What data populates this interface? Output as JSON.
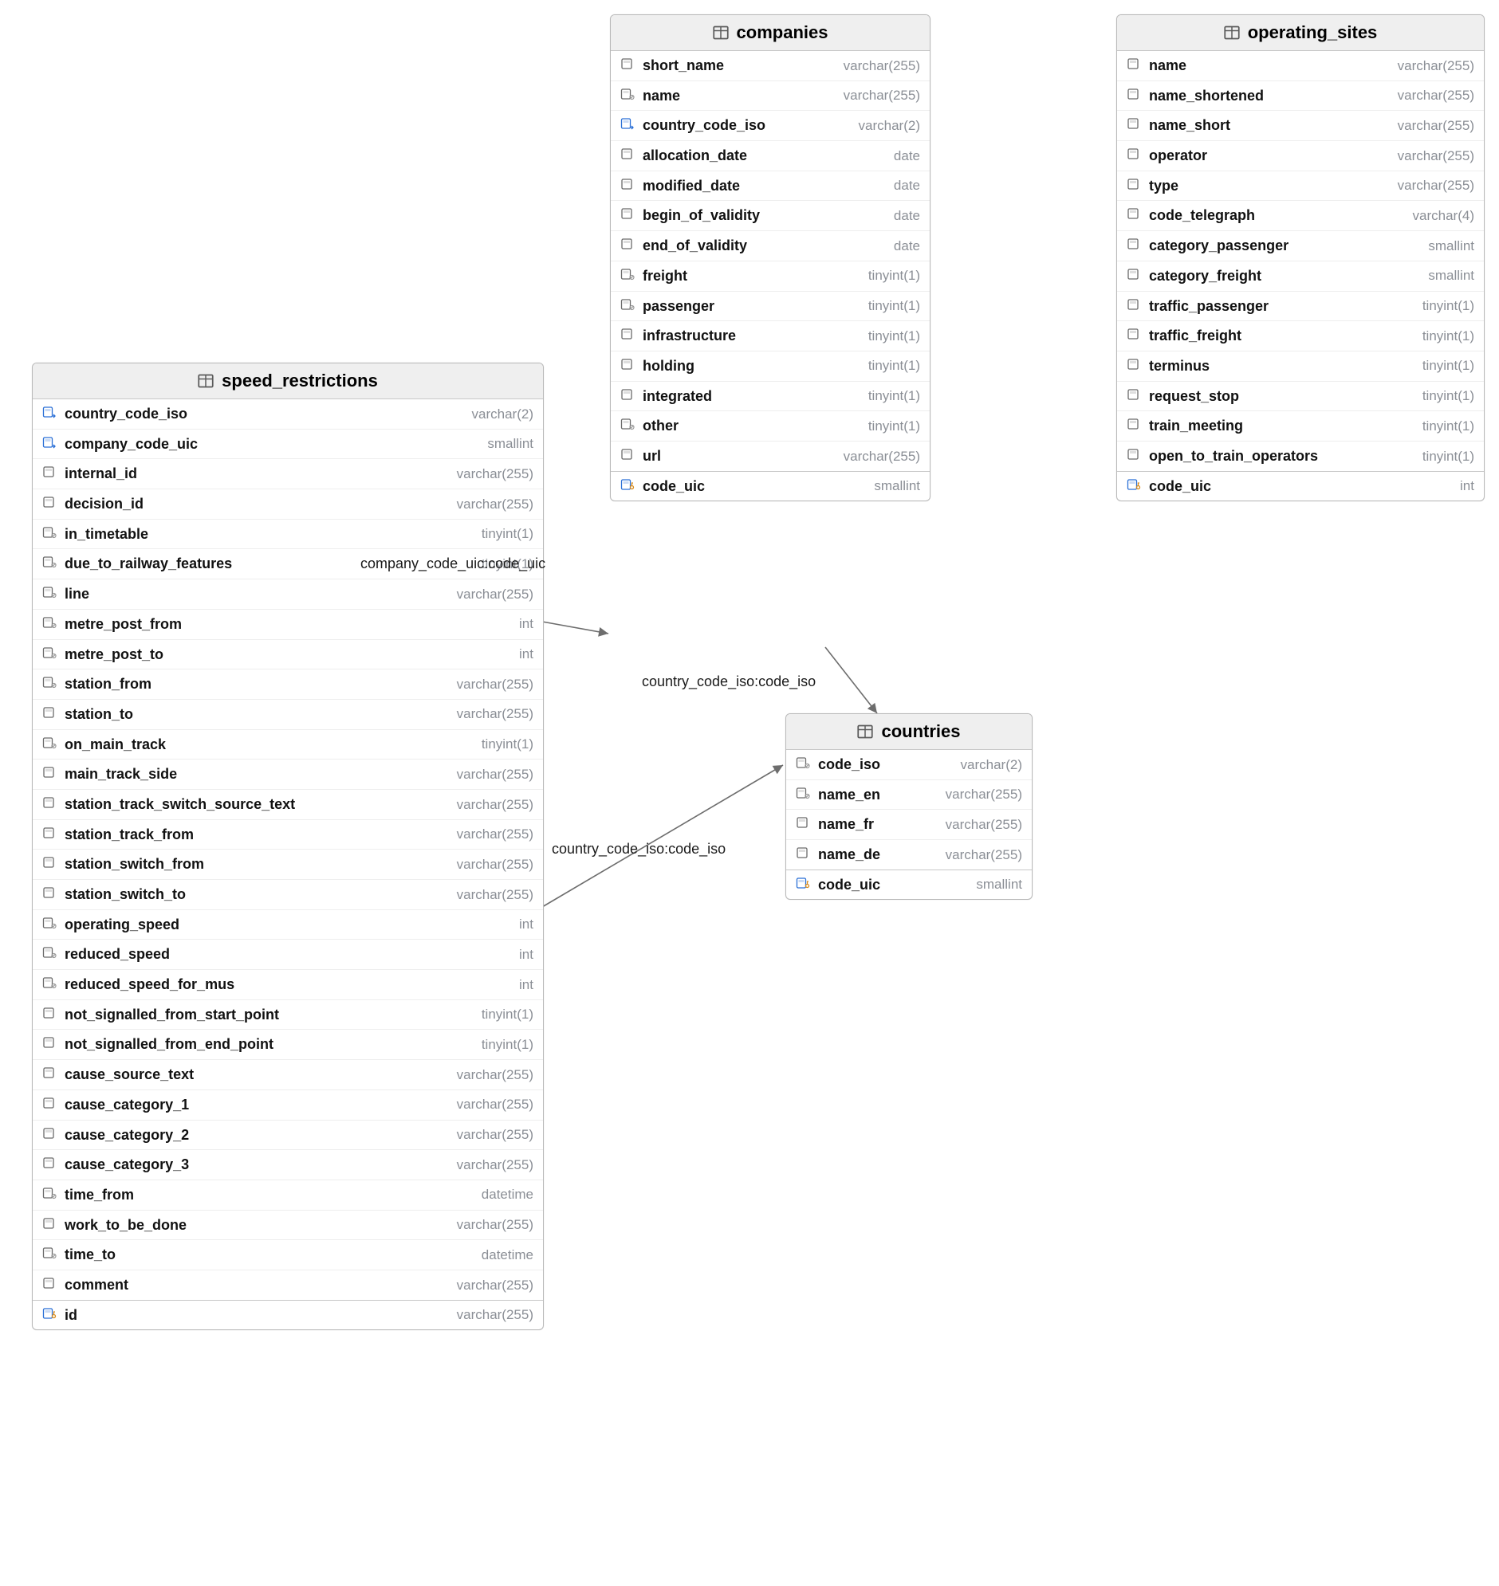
{
  "tables": {
    "speed_restrictions": {
      "title": "speed_restrictions",
      "columns": [
        {
          "icon": "fk",
          "name": "country_code_iso",
          "type": "varchar(2)"
        },
        {
          "icon": "fk",
          "name": "company_code_uic",
          "type": "smallint"
        },
        {
          "icon": "col",
          "name": "internal_id",
          "type": "varchar(255)"
        },
        {
          "icon": "col",
          "name": "decision_id",
          "type": "varchar(255)"
        },
        {
          "icon": "null",
          "name": "in_timetable",
          "type": "tinyint(1)"
        },
        {
          "icon": "null",
          "name": "due_to_railway_features",
          "type": "tinyint(1)"
        },
        {
          "icon": "null",
          "name": "line",
          "type": "varchar(255)"
        },
        {
          "icon": "null",
          "name": "metre_post_from",
          "type": "int"
        },
        {
          "icon": "null",
          "name": "metre_post_to",
          "type": "int"
        },
        {
          "icon": "null",
          "name": "station_from",
          "type": "varchar(255)"
        },
        {
          "icon": "col",
          "name": "station_to",
          "type": "varchar(255)"
        },
        {
          "icon": "null",
          "name": "on_main_track",
          "type": "tinyint(1)"
        },
        {
          "icon": "col",
          "name": "main_track_side",
          "type": "varchar(255)"
        },
        {
          "icon": "col",
          "name": "station_track_switch_source_text",
          "type": "varchar(255)"
        },
        {
          "icon": "col",
          "name": "station_track_from",
          "type": "varchar(255)"
        },
        {
          "icon": "col",
          "name": "station_switch_from",
          "type": "varchar(255)"
        },
        {
          "icon": "col",
          "name": "station_switch_to",
          "type": "varchar(255)"
        },
        {
          "icon": "null",
          "name": "operating_speed",
          "type": "int"
        },
        {
          "icon": "null",
          "name": "reduced_speed",
          "type": "int"
        },
        {
          "icon": "null",
          "name": "reduced_speed_for_mus",
          "type": "int"
        },
        {
          "icon": "col",
          "name": "not_signalled_from_start_point",
          "type": "tinyint(1)"
        },
        {
          "icon": "col",
          "name": "not_signalled_from_end_point",
          "type": "tinyint(1)"
        },
        {
          "icon": "col",
          "name": "cause_source_text",
          "type": "varchar(255)"
        },
        {
          "icon": "col",
          "name": "cause_category_1",
          "type": "varchar(255)"
        },
        {
          "icon": "col",
          "name": "cause_category_2",
          "type": "varchar(255)"
        },
        {
          "icon": "col",
          "name": "cause_category_3",
          "type": "varchar(255)"
        },
        {
          "icon": "null",
          "name": "time_from",
          "type": "datetime"
        },
        {
          "icon": "col",
          "name": "work_to_be_done",
          "type": "varchar(255)"
        },
        {
          "icon": "null",
          "name": "time_to",
          "type": "datetime"
        },
        {
          "icon": "col",
          "name": "comment",
          "type": "varchar(255)"
        },
        {
          "icon": "pk",
          "name": "id",
          "type": "varchar(255)",
          "pk": true
        }
      ]
    },
    "companies": {
      "title": "companies",
      "columns": [
        {
          "icon": "col",
          "name": "short_name",
          "type": "varchar(255)"
        },
        {
          "icon": "null",
          "name": "name",
          "type": "varchar(255)"
        },
        {
          "icon": "fk",
          "name": "country_code_iso",
          "type": "varchar(2)"
        },
        {
          "icon": "col",
          "name": "allocation_date",
          "type": "date"
        },
        {
          "icon": "col",
          "name": "modified_date",
          "type": "date"
        },
        {
          "icon": "col",
          "name": "begin_of_validity",
          "type": "date"
        },
        {
          "icon": "col",
          "name": "end_of_validity",
          "type": "date"
        },
        {
          "icon": "null",
          "name": "freight",
          "type": "tinyint(1)"
        },
        {
          "icon": "null",
          "name": "passenger",
          "type": "tinyint(1)"
        },
        {
          "icon": "col",
          "name": "infrastructure",
          "type": "tinyint(1)"
        },
        {
          "icon": "col",
          "name": "holding",
          "type": "tinyint(1)"
        },
        {
          "icon": "col",
          "name": "integrated",
          "type": "tinyint(1)"
        },
        {
          "icon": "null",
          "name": "other",
          "type": "tinyint(1)"
        },
        {
          "icon": "col",
          "name": "url",
          "type": "varchar(255)"
        },
        {
          "icon": "pk",
          "name": "code_uic",
          "type": "smallint",
          "pk": true
        }
      ]
    },
    "countries": {
      "title": "countries",
      "columns": [
        {
          "icon": "null",
          "name": "code_iso",
          "type": "varchar(2)"
        },
        {
          "icon": "null",
          "name": "name_en",
          "type": "varchar(255)"
        },
        {
          "icon": "col",
          "name": "name_fr",
          "type": "varchar(255)"
        },
        {
          "icon": "col",
          "name": "name_de",
          "type": "varchar(255)"
        },
        {
          "icon": "pk",
          "name": "code_uic",
          "type": "smallint",
          "pk": true
        }
      ]
    },
    "operating_sites": {
      "title": "operating_sites",
      "columns": [
        {
          "icon": "col",
          "name": "name",
          "type": "varchar(255)"
        },
        {
          "icon": "col",
          "name": "name_shortened",
          "type": "varchar(255)"
        },
        {
          "icon": "col",
          "name": "name_short",
          "type": "varchar(255)"
        },
        {
          "icon": "col",
          "name": "operator",
          "type": "varchar(255)"
        },
        {
          "icon": "col",
          "name": "type",
          "type": "varchar(255)"
        },
        {
          "icon": "col",
          "name": "code_telegraph",
          "type": "varchar(4)"
        },
        {
          "icon": "col",
          "name": "category_passenger",
          "type": "smallint"
        },
        {
          "icon": "col",
          "name": "category_freight",
          "type": "smallint"
        },
        {
          "icon": "col",
          "name": "traffic_passenger",
          "type": "tinyint(1)"
        },
        {
          "icon": "col",
          "name": "traffic_freight",
          "type": "tinyint(1)"
        },
        {
          "icon": "col",
          "name": "terminus",
          "type": "tinyint(1)"
        },
        {
          "icon": "col",
          "name": "request_stop",
          "type": "tinyint(1)"
        },
        {
          "icon": "col",
          "name": "train_meeting",
          "type": "tinyint(1)"
        },
        {
          "icon": "col",
          "name": "open_to_train_operators",
          "type": "tinyint(1)"
        },
        {
          "icon": "pk",
          "name": "code_uic",
          "type": "int",
          "pk": true
        }
      ]
    }
  },
  "edge_labels": {
    "e1": "company_code_uic:code_uic",
    "e2": "country_code_iso:code_iso",
    "e3": "country_code_iso:code_iso"
  }
}
